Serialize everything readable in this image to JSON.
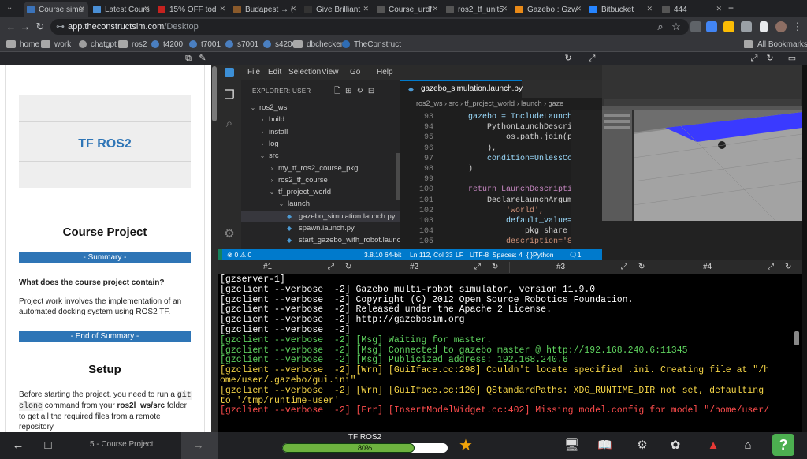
{
  "browser": {
    "tabs": [
      {
        "label": "Course simul",
        "active": true,
        "favicon_color": "#3b73b9"
      },
      {
        "label": "Latest Cours",
        "active": false,
        "favicon_color": "#4a8fd6"
      },
      {
        "label": "15% OFF tod",
        "active": false,
        "favicon_color": "#c5221f"
      },
      {
        "label": "Budapest → (",
        "active": false,
        "favicon_color": "#8a5a2b"
      },
      {
        "label": "Give Brilliant",
        "active": false,
        "favicon_color": "#333333"
      },
      {
        "label": "Course_urdf",
        "active": false,
        "favicon_color": "#555555"
      },
      {
        "label": "ros2_tf_unit5",
        "active": false,
        "favicon_color": "#555555"
      },
      {
        "label": "Gazebo : Gzw",
        "active": false,
        "favicon_color": "#e98a18"
      },
      {
        "label": "Bitbucket",
        "active": false,
        "favicon_color": "#2684ff"
      },
      {
        "label": "444",
        "active": false,
        "favicon_color": "#555555"
      }
    ],
    "url_host": "app.theconstructsim.com",
    "url_path": "/Desktop",
    "bookmarks": [
      {
        "label": "home",
        "icon": "folder-icon"
      },
      {
        "label": "work",
        "icon": "folder-icon"
      },
      {
        "label": "chatgpt",
        "icon": "chatgpt-icon"
      },
      {
        "label": "ros2",
        "icon": "folder-icon"
      },
      {
        "label": "t4200",
        "icon": "site-icon"
      },
      {
        "label": "t7001",
        "icon": "site-icon"
      },
      {
        "label": "s7001",
        "icon": "site-icon"
      },
      {
        "label": "s4200",
        "icon": "site-icon"
      },
      {
        "label": "dbchecker",
        "icon": "folder-icon"
      },
      {
        "label": "TheConstruct",
        "icon": "construct-icon"
      }
    ],
    "all_bookmarks": "All Bookmarks"
  },
  "notebook": {
    "header_title": "TF ROS2",
    "course_project_heading": "Course Project",
    "summary_bar": "- Summary -",
    "question": "What does the course project contain?",
    "project_text": "Project work involves the implementation of an automated docking system using ROS2 TF.",
    "end_summary_bar": "- End of Summary -",
    "setup_heading": "Setup",
    "setup_pre": "Before starting the project, you need to run a",
    "setup_code_1": "git",
    "setup_code_2": "clone",
    "setup_mid": "command from your",
    "setup_bold": "ros2l_ws/src",
    "setup_post": "folder",
    "setup_line3": "to get all the required files from a remote",
    "setup_line4": "repository"
  },
  "vscode": {
    "menus": [
      "File",
      "Edit",
      "Selection",
      "View",
      "Go",
      "Help"
    ],
    "explorer_header": "EXPLORER: USER",
    "tree": [
      {
        "label": "ros2_ws",
        "indent": 0,
        "kind": "open",
        "selected": false
      },
      {
        "label": "build",
        "indent": 1,
        "kind": "closed",
        "selected": false
      },
      {
        "label": "install",
        "indent": 1,
        "kind": "closed",
        "selected": false
      },
      {
        "label": "log",
        "indent": 1,
        "kind": "closed",
        "selected": false
      },
      {
        "label": "src",
        "indent": 1,
        "kind": "open",
        "selected": false
      },
      {
        "label": "my_tf_ros2_course_pkg",
        "indent": 2,
        "kind": "closed",
        "selected": false
      },
      {
        "label": "ros2_tf_course",
        "indent": 2,
        "kind": "closed",
        "selected": false
      },
      {
        "label": "tf_project_world",
        "indent": 2,
        "kind": "open",
        "selected": false
      },
      {
        "label": "launch",
        "indent": 3,
        "kind": "open",
        "selected": false
      },
      {
        "label": "gazebo_simulation.launch.py",
        "indent": 4,
        "kind": "python",
        "selected": true
      },
      {
        "label": "spawn.launch.py",
        "indent": 4,
        "kind": "python",
        "selected": false
      },
      {
        "label": "start_gazebo_with_robot.launc...",
        "indent": 4,
        "kind": "python",
        "selected": false
      }
    ],
    "editor_tab": "gazebo_simulation.launch.py",
    "breadcrumb": [
      "ros2_ws",
      "src",
      "tf_project_world",
      "launch",
      "gaze"
    ],
    "code_lines": [
      {
        "n": "93",
        "t": "    gazebo = IncludeLaunchDes"
      },
      {
        "n": "94",
        "t": "        PythonLaunchDescripti"
      },
      {
        "n": "95",
        "t": "            os.path.join(pkg_"
      },
      {
        "n": "96",
        "t": "        ),"
      },
      {
        "n": "97",
        "t": "        condition=UnlessCondi"
      },
      {
        "n": "98",
        "t": "    )"
      },
      {
        "n": "99",
        "t": ""
      },
      {
        "n": "100",
        "t": "    return LaunchDescription("
      },
      {
        "n": "101",
        "t": "        DeclareLaunchArgument"
      },
      {
        "n": "102",
        "t": "            'world',"
      },
      {
        "n": "103",
        "t": "            default_value=[os"
      },
      {
        "n": "104",
        "t": "                pkg_share_dir"
      },
      {
        "n": "105",
        "t": "            description='SDF"
      }
    ],
    "status": {
      "problems": "⊗ 0 ⚠ 0",
      "python_version": "3.8.10 64-bit",
      "position": "Ln 112, Col 33",
      "eol": "LF",
      "encoding": "UTF-8",
      "spaces": "Spaces: 4",
      "language": "Python",
      "notifications": "1"
    }
  },
  "terminal": {
    "tabs": [
      "#1",
      "#2",
      "#3",
      "#4"
    ],
    "lines": [
      {
        "text": "[gzserver-1]",
        "color": "#ffffff"
      },
      {
        "text": "[gzclient --verbose  -2] Gazebo multi-robot simulator, version 11.9.0",
        "color": "#ffffff"
      },
      {
        "text": "[gzclient --verbose  -2] Copyright (C) 2012 Open Source Robotics Foundation.",
        "color": "#ffffff"
      },
      {
        "text": "[gzclient --verbose  -2] Released under the Apache 2 License.",
        "color": "#ffffff"
      },
      {
        "text": "[gzclient --verbose  -2] http://gazebosim.org",
        "color": "#ffffff"
      },
      {
        "text": "[gzclient --verbose  -2]",
        "color": "#ffffff"
      },
      {
        "text": "[gzclient --verbose  -2] [Msg] Waiting for master.",
        "color": "#5fd35f",
        "prefix_color": "#5fd35f"
      },
      {
        "text": "[gzclient --verbose  -2] [Msg] Connected to gazebo master @ http://192.168.240.6:11345",
        "color": "#5fd35f"
      },
      {
        "text": "[gzclient --verbose  -2] [Msg] Publicized address: 192.168.240.6",
        "color": "#5fd35f"
      },
      {
        "text": "[gzclient --verbose  -2] [Wrn] [GuiIface.cc:298] Couldn't locate specified .ini. Creating file at \"/h",
        "color": "#f5d547"
      },
      {
        "text": "ome/user/.gazebo/gui.ini\"",
        "color": "#f5d547"
      },
      {
        "text": "[gzclient --verbose  -2] [Wrn] [GuiIface.cc:120] QStandardPaths: XDG_RUNTIME_DIR not set, defaulting",
        "color": "#f5d547"
      },
      {
        "text": "to '/tmp/runtime-user'",
        "color": "#f5d547"
      },
      {
        "text": "[gzclient --verbose  -2] [Err] [InsertModelWidget.cc:402] Missing model.config for model \"/home/user/",
        "color": "#ff4d4d"
      }
    ]
  },
  "bottom": {
    "unit_label": "5 - Course Project",
    "course_title": "TF ROS2",
    "progress_text": "80%",
    "progress_value": 0.8,
    "help_label": "?"
  }
}
